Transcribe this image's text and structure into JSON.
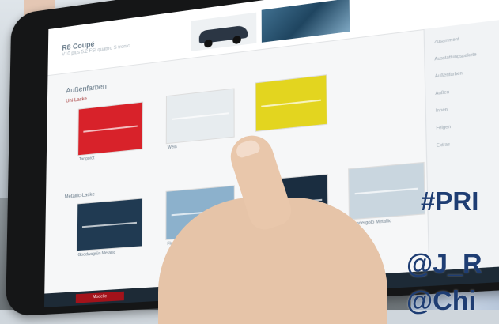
{
  "screen": {
    "model_title": "R8 Coupé",
    "model_subtitle": "V10 plus 5.2 FSI quattro S tronic",
    "section_title": "Außenfarben",
    "group1_label": "Uni-Lacke",
    "group2_label": "Metallic-Lacke",
    "swatches_row1": [
      {
        "label": "Tangorot",
        "color": "#d8222a"
      },
      {
        "label": "Weiß",
        "color": "#e7ecef"
      },
      {
        "label": "",
        "color": "#e3d51f"
      }
    ],
    "swatches_row2": [
      {
        "label": "Goodwagrün Metallic",
        "color": "#203a52"
      },
      {
        "label": "Flor...",
        "color": "#8cb1cc"
      },
      {
        "label": "",
        "color": "#1a2d40"
      },
      {
        "label": "Sondergolo Metallic",
        "color": "#c9d6df"
      }
    ],
    "sidebar_items": [
      "Zusammenf.",
      "Ausstattungspakete",
      "Außenfarben",
      "Außen",
      "Innen",
      "Felgen",
      "Extras"
    ],
    "bottom_button": "Modelle"
  },
  "overlay_text": {
    "line1": "#PRI",
    "line2": "@J_R",
    "line3": "@Chi"
  },
  "colors": {
    "overlay": "#1e3d73",
    "accent_red": "#a3121a"
  }
}
